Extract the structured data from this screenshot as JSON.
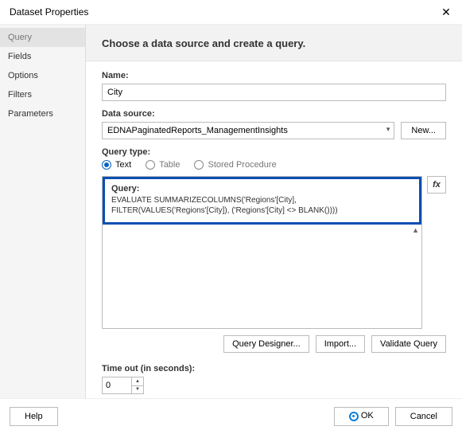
{
  "window": {
    "title": "Dataset Properties",
    "close": "✕"
  },
  "sidebar": {
    "items": [
      {
        "label": "Query"
      },
      {
        "label": "Fields"
      },
      {
        "label": "Options"
      },
      {
        "label": "Filters"
      },
      {
        "label": "Parameters"
      }
    ]
  },
  "header": {
    "text": "Choose a data source and create a query."
  },
  "form": {
    "name_label": "Name:",
    "name_value": "City",
    "ds_label": "Data source:",
    "ds_value": "EDNAPaginatedReports_ManagementInsights",
    "new_btn": "New...",
    "qtype_label": "Query type:",
    "qtype": {
      "text": "Text",
      "table": "Table",
      "sp": "Stored Procedure"
    },
    "query_label": "Query:",
    "query_text": "EVALUATE SUMMARIZECOLUMNS('Regions'[City], FILTER(VALUES('Regions'[City]), ('Regions'[City] <> BLANK())))",
    "fx": "fx",
    "buttons": {
      "designer": "Query Designer...",
      "import": "Import...",
      "validate": "Validate Query"
    },
    "timeout_label": "Time out (in seconds):",
    "timeout_value": "0"
  },
  "footer": {
    "help": "Help",
    "ok": "OK",
    "cancel": "Cancel"
  }
}
